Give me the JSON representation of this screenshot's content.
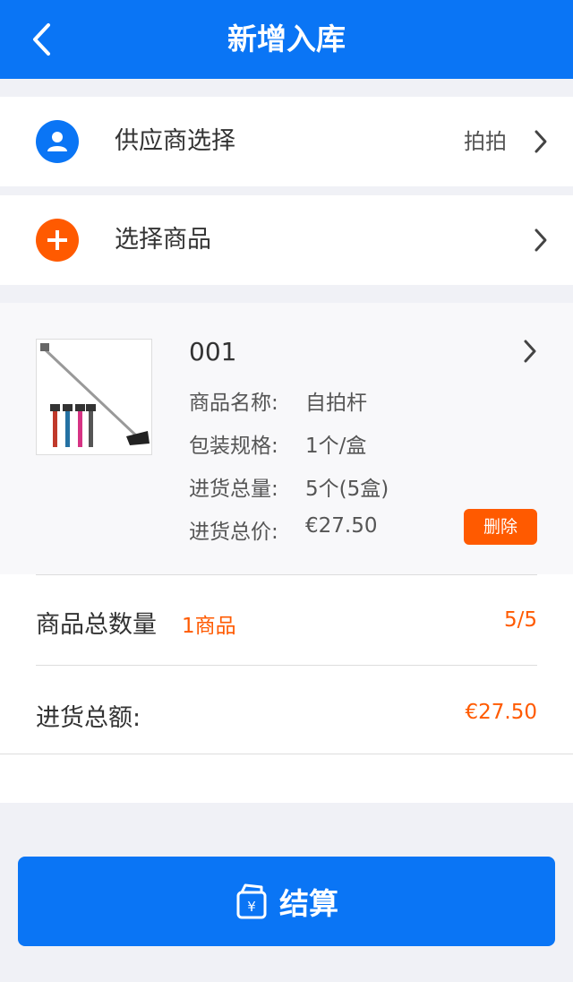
{
  "header": {
    "title": "新增入库",
    "back_icon": "chevron-left-icon"
  },
  "supplier_row": {
    "label": "供应商选择",
    "value": "拍拍",
    "icon": "user-icon",
    "icon_color": "#0a75f5"
  },
  "select_goods_row": {
    "label": "选择商品",
    "icon": "plus-icon",
    "icon_color": "#ff5a00"
  },
  "product": {
    "code": "001",
    "name_label": "商品名称:",
    "name": "自拍杆",
    "pack_label": "包装规格:",
    "pack": "1个/盒",
    "qty_label": "进货总量:",
    "qty": "5个(5盒)",
    "price_label": "进货总价:",
    "price": "€27.50",
    "delete_label": "删除"
  },
  "summary": {
    "count_label": "商品总数量",
    "count_sub": "1商品",
    "count_value": "5/5",
    "total_label": "进货总额:",
    "total_value": "€27.50"
  },
  "checkout": {
    "label": "结算",
    "icon": "wallet-yen-icon"
  },
  "colors": {
    "primary": "#0a75f5",
    "accent": "#ff5a00"
  }
}
